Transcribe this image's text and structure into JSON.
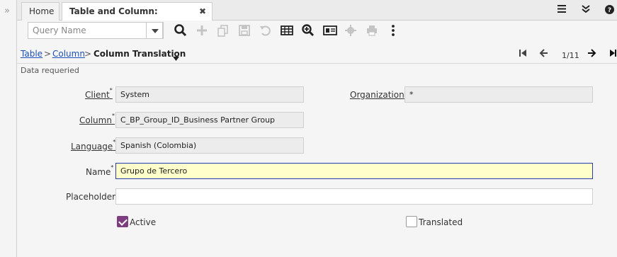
{
  "sidebar": {
    "expand_glyph": "»"
  },
  "tabs": [
    {
      "label": "Home"
    },
    {
      "label": "Table and Column: Business ...",
      "close": "✖"
    }
  ],
  "query": {
    "placeholder": "Query Name"
  },
  "toolbar": {
    "icons": [
      "search-icon",
      "new-icon",
      "copy-icon",
      "save-icon",
      "undo-icon",
      "grid-toggle-icon",
      "zoom-icon",
      "report-icon",
      "process-icon",
      "print-icon",
      "more-icon"
    ]
  },
  "breadcrumb": {
    "items": [
      {
        "label": "Table",
        "link": true
      },
      {
        "label": ">",
        "link": false
      },
      {
        "label": "Column",
        "link": true
      },
      {
        "label": ">",
        "link": false
      },
      {
        "label": "Column Translation",
        "link": false
      }
    ],
    "pager": "1/11"
  },
  "status": "Data requeried",
  "form": {
    "client": {
      "label": "Client",
      "value": "System",
      "mandatory": "*"
    },
    "organization": {
      "label": "Organization",
      "value": "*",
      "mandatory": "*"
    },
    "column": {
      "label": "Column",
      "value": "C_BP_Group_ID_Business Partner Group",
      "mandatory": "*"
    },
    "language": {
      "label": "Language",
      "value": "Spanish (Colombia)",
      "mandatory": "*"
    },
    "name": {
      "label": "Name",
      "value": "Grupo de Tercero",
      "mandatory": "*"
    },
    "placeholder": {
      "label": "Placeholder",
      "value": ""
    },
    "active": {
      "label": "Active",
      "checked": true
    },
    "translated": {
      "label": "Translated",
      "checked": false
    }
  },
  "colors": {
    "accent": "#7e3d7e",
    "link": "#1a4fb5",
    "focus_bg": "#ffffcc"
  }
}
